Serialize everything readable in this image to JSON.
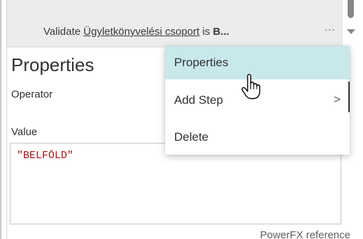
{
  "step": {
    "title_prefix": "Validate ",
    "title_link": "Ügyletkönyvelési csoport",
    "title_middle": " is ",
    "title_bold": "B...",
    "more_icon": "⋯"
  },
  "panel": {
    "heading": "Properties",
    "operator_label": "Operator",
    "value_label": "Value",
    "value_code": "\"BELFÖLD\"",
    "powerfx_link": "PowerFX reference"
  },
  "menu": {
    "items": [
      {
        "label": "Properties",
        "active": true
      },
      {
        "label": "Add Step",
        "has_submenu": true,
        "chevron": ">"
      },
      {
        "label": "Delete"
      }
    ]
  },
  "colors": {
    "menu_active_bg": "#c8e8ec",
    "code_string": "#a31515",
    "card_bg": "#ececec"
  },
  "icons": {
    "more": "more-icon",
    "cursor": "hand-pointer-icon",
    "chevron": "chevron-right-icon",
    "scroll": "scroll-down-icon"
  }
}
